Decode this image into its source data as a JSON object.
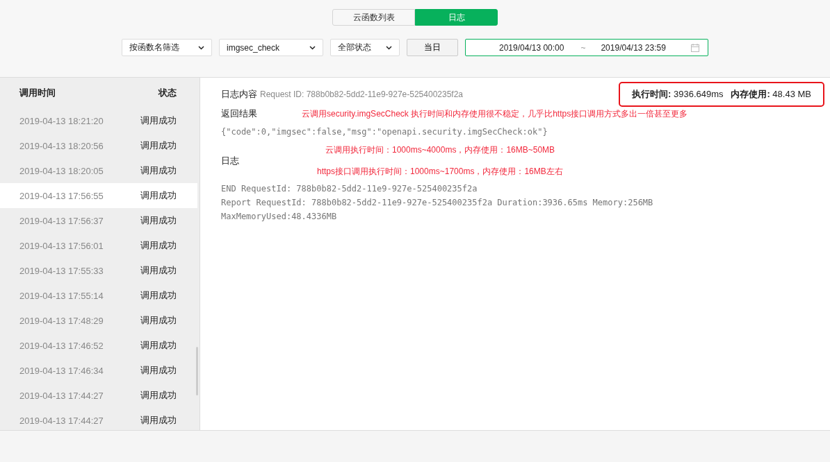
{
  "tabs": [
    {
      "label": "云函数列表",
      "selected": false
    },
    {
      "label": "日志",
      "selected": true
    }
  ],
  "filters": {
    "dropdowns": [
      "按函数名筛选",
      "imgsec_check",
      "全部状态"
    ],
    "today_button": "当日",
    "date_from": "2019/04/13 00:00",
    "date_separator": "~",
    "date_to": "2019/04/13 23:59"
  },
  "log_list": {
    "columns": [
      "调用时间",
      "状态"
    ],
    "rows": [
      {
        "time": "2019-04-13 18:21:20",
        "status": "调用成功",
        "selected": false
      },
      {
        "time": "2019-04-13 18:20:56",
        "status": "调用成功",
        "selected": false
      },
      {
        "time": "2019-04-13 18:20:05",
        "status": "调用成功",
        "selected": false
      },
      {
        "time": "2019-04-13 17:56:55",
        "status": "调用成功",
        "selected": true
      },
      {
        "time": "2019-04-13 17:56:37",
        "status": "调用成功",
        "selected": false
      },
      {
        "time": "2019-04-13 17:56:01",
        "status": "调用成功",
        "selected": false
      },
      {
        "time": "2019-04-13 17:55:33",
        "status": "调用成功",
        "selected": false
      },
      {
        "time": "2019-04-13 17:55:14",
        "status": "调用成功",
        "selected": false
      },
      {
        "time": "2019-04-13 17:48:29",
        "status": "调用成功",
        "selected": false
      },
      {
        "time": "2019-04-13 17:46:52",
        "status": "调用成功",
        "selected": false
      },
      {
        "time": "2019-04-13 17:46:34",
        "status": "调用成功",
        "selected": false
      },
      {
        "time": "2019-04-13 17:44:27",
        "status": "调用成功",
        "selected": false
      },
      {
        "time": "2019-04-13 17:44:27",
        "status": "调用成功",
        "selected": false
      }
    ]
  },
  "detail": {
    "title": "日志内容",
    "request_id": "Request ID: 788b0b82-5dd2-11e9-927e-525400235f2a",
    "stats": "**执行时间:** 3936.649ms   **内存使用:** 48.43 MB",
    "result_label": "返回结果",
    "result": "{\"code\":0,\"imgsec\":false,\"msg\":\"openapi.security.imgSecCheck:ok\"}",
    "log_label": "日志",
    "log_lines": [
      "END RequestId: 788b0b82-5dd2-11e9-927e-525400235f2a",
      "Report RequestId: 788b0b82-5dd2-11e9-927e-525400235f2a Duration:3936.65ms Memory:256MB",
      "MaxMemoryUsed:48.4336MB"
    ]
  },
  "annotations": [
    "云调用security.imgSecCheck 执行时间和内存使用很不稳定，几乎比https接口调用方式多出一倍甚至更多",
    "云调用执行时间：1000ms~4000ms，内存使用：16MB~50MB",
    "https接口调用执行时间：1000ms~1700ms，内存使用：16MB左右"
  ]
}
